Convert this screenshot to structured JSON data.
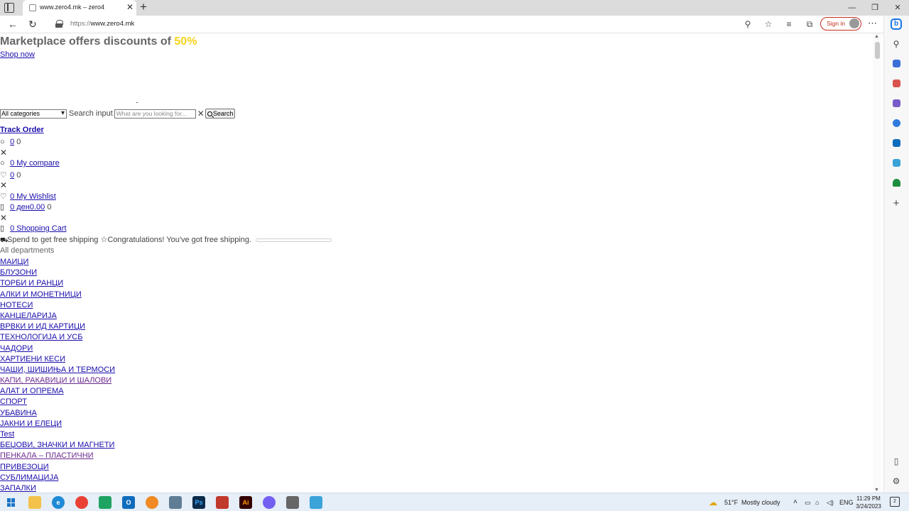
{
  "browser": {
    "tab_title": "www.zero4.mk – zero4",
    "url_prefix": "https://",
    "url_host": "www.zero4.mk",
    "sign_in_label": "Sign in"
  },
  "promo": {
    "title_text": "Marketplace offers discounts of ",
    "title_highlight": "50%",
    "link_label": "Shop now",
    "highlight_color": "#f7d31c"
  },
  "search": {
    "category_selected": "All categories",
    "label": "Search input",
    "placeholder": "What are you looking for...",
    "button_label": "Search"
  },
  "header_links": {
    "track_order": "Track Order",
    "compare_count_link": "0",
    "compare_count_text": "0",
    "compare_link": "0 My compare",
    "wishlist_count_link": "0",
    "wishlist_count_text": "0",
    "wishlist_link": "0 My Wishlist",
    "cart_total_link": "0 ден0.00",
    "cart_total_text": "0",
    "cart_link": "0 Shopping Cart",
    "shipping_text": "Spend to get free shipping",
    "shipping_congrats": "Congratulations! You've got free shipping.",
    "shipping_progress": 0
  },
  "departments": {
    "header": "All departments",
    "items": [
      "МАИЦИ",
      "БЛУЗОНИ",
      "ТОРБИ И РАНЦИ",
      "АЛКИ И МОНЕТНИЦИ",
      "НОТЕСИ",
      "КАНЦЕЛАРИЈА",
      "ВРВКИ И ИД КАРТИЦИ",
      "ТЕХНОЛОГИЈА И УСБ",
      "ЧАДОРИ",
      "ХАРТИЕНИ КЕСИ",
      "ЧАШИ, ШИШИЊА И ТЕРМОСИ",
      "КАПИ, РАКАВИЦИ И ШАЛОВИ",
      "АЛАТ И ОПРЕМА",
      "СПОРТ",
      "УБАВИНА",
      "ЈАКНИ И ЕЛЕЦИ",
      "Test",
      "БЕЏОВИ, ЗНАЧКИ И МАГНЕТИ",
      "ПЕНКАЛА – ПЛАСТИЧНИ",
      "ПРИВЕЗОЦИ",
      "СУБЛИМАЦИЈА",
      "ЗАПАЛКИ"
    ]
  },
  "taskbar": {
    "weather_temp": "51°F",
    "weather_desc": "Mostly cloudy",
    "language": "ENG",
    "time": "11:29 PM",
    "date": "3/24/2023",
    "notifications": "2"
  }
}
